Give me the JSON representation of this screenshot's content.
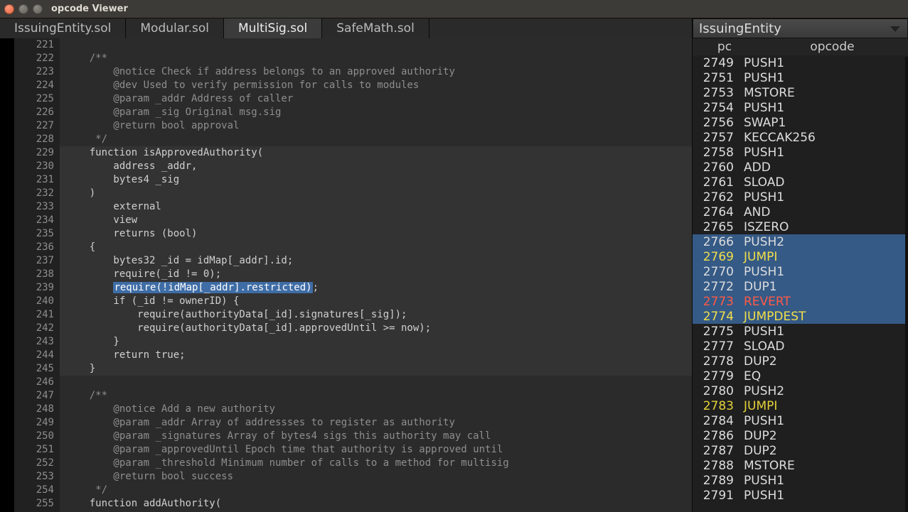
{
  "titlebar": {
    "title": "opcode Viewer"
  },
  "tabs": [
    "IssuingEntity.sol",
    "Modular.sol",
    "MultiSig.sol",
    "SafeMath.sol"
  ],
  "active_tab": 2,
  "code": {
    "first_line": 221,
    "selection_line": 239,
    "selection_text": "require(!idMap[_addr].restricted)",
    "fn_highlight_start": 229,
    "fn_highlight_end": 245,
    "lines": [
      {
        "n": 221,
        "t": "",
        "c": ""
      },
      {
        "n": 222,
        "t": "    /**",
        "c": "comment"
      },
      {
        "n": 223,
        "t": "        @notice Check if address belongs to an approved authority",
        "c": "comment"
      },
      {
        "n": 224,
        "t": "        @dev Used to verify permission for calls to modules",
        "c": "comment"
      },
      {
        "n": 225,
        "t": "        @param _addr Address of caller",
        "c": "comment"
      },
      {
        "n": 226,
        "t": "        @param _sig Original msg.sig",
        "c": "comment"
      },
      {
        "n": 227,
        "t": "        @return bool approval",
        "c": "comment"
      },
      {
        "n": 228,
        "t": "     */",
        "c": "comment"
      },
      {
        "n": 229,
        "t": "    function isApprovedAuthority(",
        "c": ""
      },
      {
        "n": 230,
        "t": "        address _addr,",
        "c": ""
      },
      {
        "n": 231,
        "t": "        bytes4 _sig",
        "c": ""
      },
      {
        "n": 232,
        "t": "    )",
        "c": ""
      },
      {
        "n": 233,
        "t": "        external",
        "c": ""
      },
      {
        "n": 234,
        "t": "        view",
        "c": ""
      },
      {
        "n": 235,
        "t": "        returns (bool)",
        "c": ""
      },
      {
        "n": 236,
        "t": "    {",
        "c": ""
      },
      {
        "n": 237,
        "t": "        bytes32 _id = idMap[_addr].id;",
        "c": ""
      },
      {
        "n": 238,
        "t": "        require(_id != 0);",
        "c": ""
      },
      {
        "n": 239,
        "t": "        require(!idMap[_addr].restricted);",
        "c": ""
      },
      {
        "n": 240,
        "t": "        if (_id != ownerID) {",
        "c": ""
      },
      {
        "n": 241,
        "t": "            require(authorityData[_id].signatures[_sig]);",
        "c": ""
      },
      {
        "n": 242,
        "t": "            require(authorityData[_id].approvedUntil >= now);",
        "c": ""
      },
      {
        "n": 243,
        "t": "        }",
        "c": ""
      },
      {
        "n": 244,
        "t": "        return true;",
        "c": ""
      },
      {
        "n": 245,
        "t": "    }",
        "c": ""
      },
      {
        "n": 246,
        "t": "",
        "c": ""
      },
      {
        "n": 247,
        "t": "    /**",
        "c": "comment"
      },
      {
        "n": 248,
        "t": "        @notice Add a new authority",
        "c": "comment"
      },
      {
        "n": 249,
        "t": "        @param _addr Array of addressses to register as authority",
        "c": "comment"
      },
      {
        "n": 250,
        "t": "        @param _signatures Array of bytes4 sigs this authority may call",
        "c": "comment"
      },
      {
        "n": 251,
        "t": "        @param _approvedUntil Epoch time that authority is approved until",
        "c": "comment"
      },
      {
        "n": 252,
        "t": "        @param _threshold Minimum number of calls to a method for multisig",
        "c": "comment"
      },
      {
        "n": 253,
        "t": "        @return bool success",
        "c": "comment"
      },
      {
        "n": 254,
        "t": "     */",
        "c": "comment"
      },
      {
        "n": 255,
        "t": "    function addAuthority(",
        "c": ""
      }
    ]
  },
  "right": {
    "combo_label": "IssuingEntity",
    "header": {
      "pc": "pc",
      "opcode": "opcode"
    },
    "rows": [
      {
        "pc": 2749,
        "op": "PUSH1",
        "k": ""
      },
      {
        "pc": 2751,
        "op": "PUSH1",
        "k": ""
      },
      {
        "pc": 2753,
        "op": "MSTORE",
        "k": ""
      },
      {
        "pc": 2754,
        "op": "PUSH1",
        "k": ""
      },
      {
        "pc": 2756,
        "op": "SWAP1",
        "k": ""
      },
      {
        "pc": 2757,
        "op": "KECCAK256",
        "k": ""
      },
      {
        "pc": 2758,
        "op": "PUSH1",
        "k": ""
      },
      {
        "pc": 2760,
        "op": "ADD",
        "k": ""
      },
      {
        "pc": 2761,
        "op": "SLOAD",
        "k": ""
      },
      {
        "pc": 2762,
        "op": "PUSH1",
        "k": ""
      },
      {
        "pc": 2764,
        "op": "AND",
        "k": ""
      },
      {
        "pc": 2765,
        "op": "ISZERO",
        "k": ""
      },
      {
        "pc": 2766,
        "op": "PUSH2",
        "k": "hl"
      },
      {
        "pc": 2769,
        "op": "JUMPI",
        "k": "hl y"
      },
      {
        "pc": 2770,
        "op": "PUSH1",
        "k": "hl"
      },
      {
        "pc": 2772,
        "op": "DUP1",
        "k": "hl"
      },
      {
        "pc": 2773,
        "op": "REVERT",
        "k": "hl r"
      },
      {
        "pc": 2774,
        "op": "JUMPDEST",
        "k": "hl y"
      },
      {
        "pc": 2775,
        "op": "PUSH1",
        "k": ""
      },
      {
        "pc": 2777,
        "op": "SLOAD",
        "k": ""
      },
      {
        "pc": 2778,
        "op": "DUP2",
        "k": ""
      },
      {
        "pc": 2779,
        "op": "EQ",
        "k": ""
      },
      {
        "pc": 2780,
        "op": "PUSH2",
        "k": ""
      },
      {
        "pc": 2783,
        "op": "JUMPI",
        "k": "y"
      },
      {
        "pc": 2784,
        "op": "PUSH1",
        "k": ""
      },
      {
        "pc": 2786,
        "op": "DUP2",
        "k": ""
      },
      {
        "pc": 2787,
        "op": "DUP2",
        "k": ""
      },
      {
        "pc": 2788,
        "op": "MSTORE",
        "k": ""
      },
      {
        "pc": 2789,
        "op": "PUSH1",
        "k": ""
      },
      {
        "pc": 2791,
        "op": "PUSH1",
        "k": ""
      }
    ]
  }
}
